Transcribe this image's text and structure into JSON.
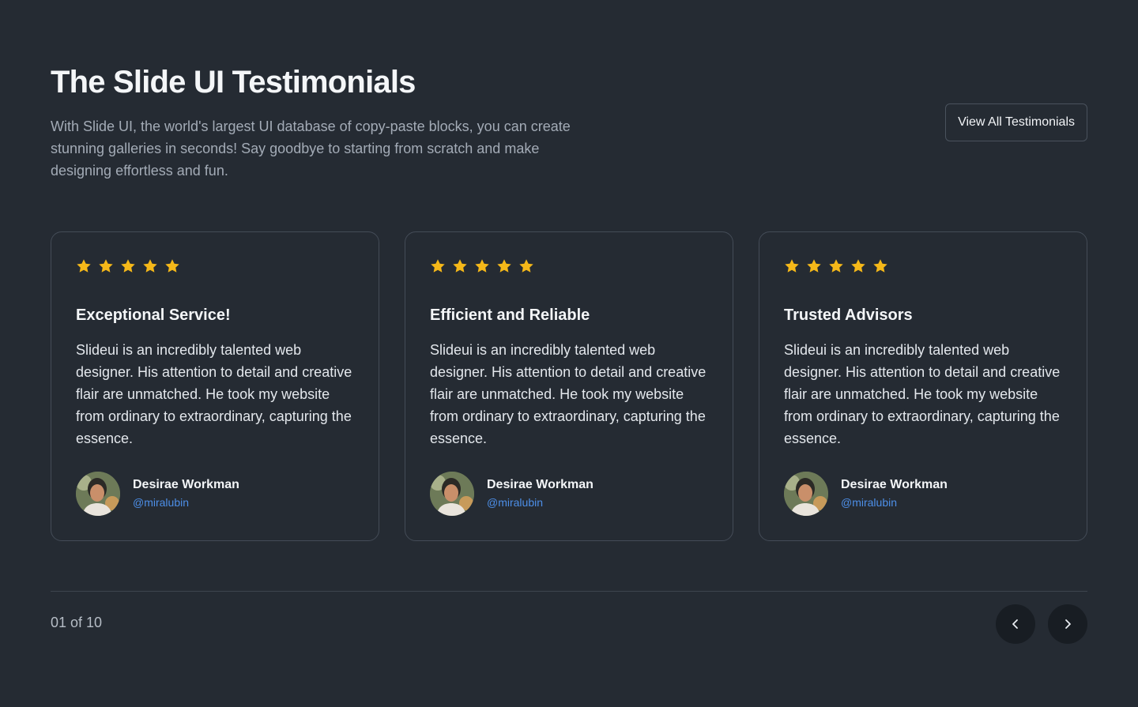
{
  "header": {
    "title": "The Slide UI Testimonials",
    "description": "With Slide UI, the world's largest UI database of copy-paste blocks, you can create stunning galleries in seconds! Say goodbye to starting from scratch and make designing effortless and fun.",
    "view_all_label": "View All Testimonials"
  },
  "testimonials": [
    {
      "rating": 5,
      "title": "Exceptional Service!",
      "text": "Slideui is an incredibly talented web designer. His attention to detail and creative flair are unmatched. He took my website from ordinary to extraordinary, capturing the essence.",
      "author_name": "Desirae Workman",
      "author_handle": "@miralubin"
    },
    {
      "rating": 5,
      "title": "Efficient and Reliable",
      "text": "Slideui is an incredibly talented web designer. His attention to detail and creative flair are unmatched. He took my website from ordinary to extraordinary, capturing the essence.",
      "author_name": "Desirae Workman",
      "author_handle": "@miralubin"
    },
    {
      "rating": 5,
      "title": "Trusted Advisors",
      "text": "Slideui is an incredibly talented web designer. His attention to detail and creative flair are unmatched. He took my website from ordinary to extraordinary, capturing the essence.",
      "author_name": "Desirae Workman",
      "author_handle": "@miralubin"
    }
  ],
  "pagination": {
    "counter": "01 of 10",
    "prev_icon": "chevron-left-icon",
    "next_icon": "chevron-right-icon"
  },
  "colors": {
    "background": "#252b33",
    "star": "#f5b819",
    "handle": "#4d8fe8",
    "nav_button": "#181d23"
  }
}
